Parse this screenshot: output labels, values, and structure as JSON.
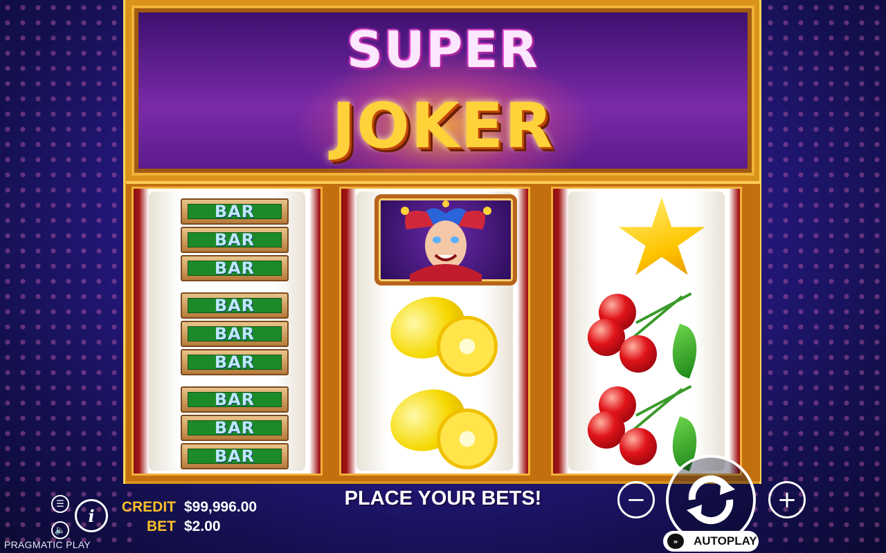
{
  "game": {
    "title_line1": "SUPER",
    "title_line2": "JOKER",
    "provider": "PRAGMATIC PLAY"
  },
  "reels": [
    {
      "symbols": [
        "BAR",
        "BAR",
        "BAR",
        "BAR",
        "BAR",
        "BAR",
        "BAR",
        "BAR",
        "BAR"
      ]
    },
    {
      "symbols": [
        "joker-icon",
        "lemon-icon",
        "lemon-icon"
      ]
    },
    {
      "symbols": [
        "star-icon",
        "cherry-icon",
        "cherry-icon"
      ]
    }
  ],
  "bar_label": "BAR",
  "hud": {
    "credit_label": "CREDIT",
    "credit_value": "$99,996.00",
    "bet_label": "BET",
    "bet_value": "$2.00",
    "message": "PLACE YOUR BETS!",
    "minus_label": "−",
    "plus_label": "+",
    "autoplay_label": "AUTOPLAY",
    "info_label": "i"
  },
  "colors": {
    "accent_gold": "#ffbf2a",
    "bar_green": "#1d8a2a",
    "reel_red": "#a31616"
  }
}
